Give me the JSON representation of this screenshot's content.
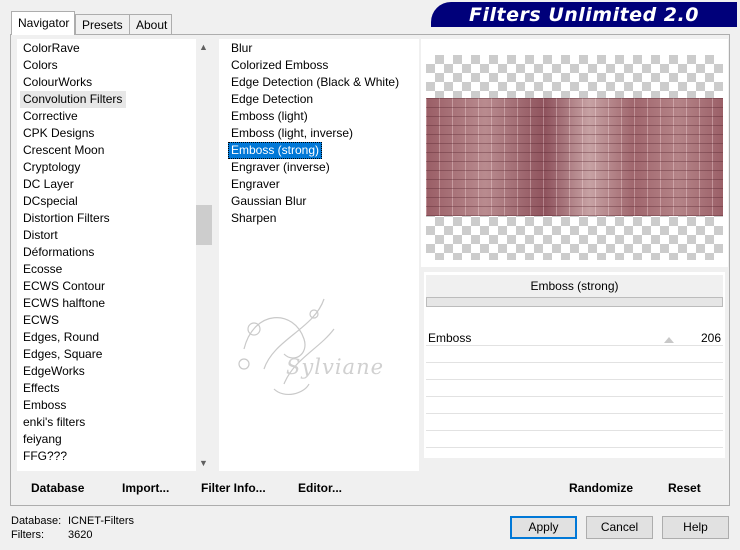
{
  "tabs": [
    {
      "label": "Navigator",
      "active": true
    },
    {
      "label": "Presets",
      "active": false
    },
    {
      "label": "About",
      "active": false
    }
  ],
  "banner_title": "Filters Unlimited 2.0",
  "categories": [
    "ColorRave",
    "Colors",
    "ColourWorks",
    "Convolution Filters",
    "Corrective",
    "CPK Designs",
    "Crescent Moon",
    "Cryptology",
    "DC Layer",
    "DCspecial",
    "Distortion Filters",
    "Distort",
    "Déformations",
    "Ecosse",
    "ECWS Contour",
    "ECWS halftone",
    "ECWS",
    "Edges, Round",
    "Edges, Square",
    "EdgeWorks",
    "Effects",
    "Emboss",
    "enki's filters",
    "feiyang",
    "FFG???"
  ],
  "selected_category": "Convolution Filters",
  "filters": [
    "Blur",
    "Colorized Emboss",
    "Edge Detection (Black & White)",
    "Edge Detection",
    "Emboss (light)",
    "Emboss (light, inverse)",
    "Emboss (strong)",
    "Engraver (inverse)",
    "Engraver",
    "Gaussian Blur",
    "Sharpen"
  ],
  "selected_filter": "Emboss (strong)",
  "current_filter_name": "Emboss (strong)",
  "parameters": [
    {
      "label": "Emboss",
      "value": "206"
    }
  ],
  "watermark": "Sylviane",
  "buttons": {
    "database": "Database",
    "import": "Import...",
    "filter_info": "Filter Info...",
    "editor": "Editor...",
    "randomize": "Randomize",
    "reset": "Reset",
    "apply": "Apply",
    "cancel": "Cancel",
    "help": "Help"
  },
  "status": {
    "database_label": "Database:",
    "database_value": "ICNET-Filters",
    "filters_label": "Filters:",
    "filters_value": "3620"
  },
  "colors": {
    "banner": "#00007a",
    "selection": "#0078d7"
  }
}
